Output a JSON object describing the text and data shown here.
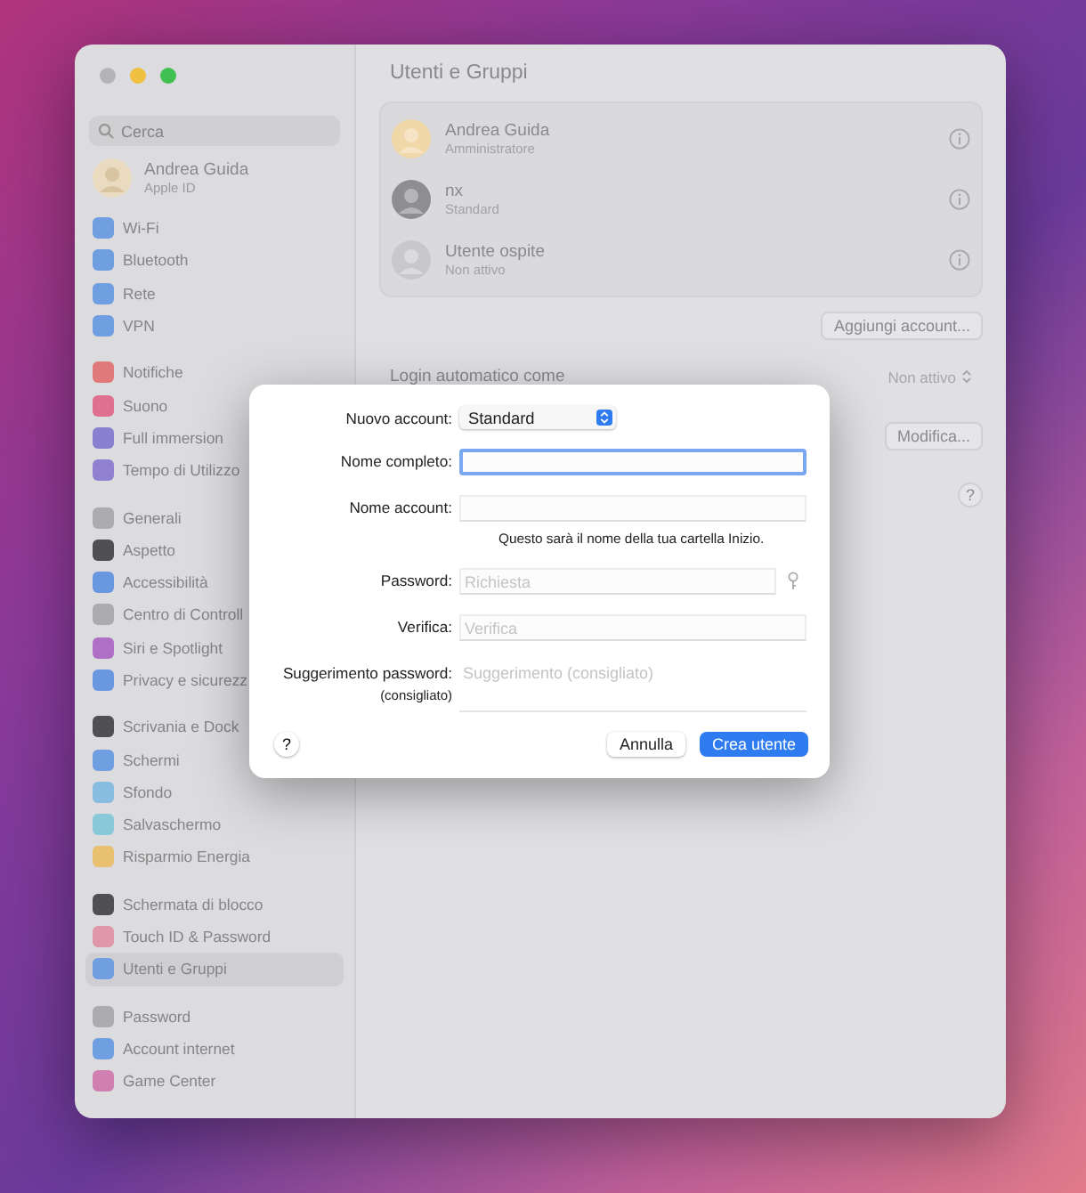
{
  "window": {
    "title": "Utenti e Gruppi"
  },
  "sidebar": {
    "search": {
      "placeholder": "Cerca"
    },
    "profile": {
      "name": "Andrea Guida",
      "subtitle": "Apple ID"
    },
    "groups": [
      [
        {
          "label": "Wi-Fi",
          "color": "#6f9fe0",
          "selected": false
        },
        {
          "label": "Bluetooth",
          "color": "#6f9fe0",
          "selected": false
        },
        {
          "label": "Rete",
          "color": "#6f9fe0",
          "selected": false
        },
        {
          "label": "VPN",
          "color": "#6f9fe0",
          "selected": false
        }
      ],
      [
        {
          "label": "Notifiche",
          "color": "#e07a7a",
          "selected": false
        },
        {
          "label": "Suono",
          "color": "#e07090",
          "selected": false
        },
        {
          "label": "Full immersion",
          "color": "#8a80d0",
          "selected": false
        },
        {
          "label": "Tempo di Utilizzo",
          "color": "#9080d0",
          "selected": false
        }
      ],
      [
        {
          "label": "Generali",
          "color": "#acacb0",
          "selected": false
        },
        {
          "label": "Aspetto",
          "color": "#505052",
          "selected": false
        },
        {
          "label": "Accessibilità",
          "color": "#6a98e0",
          "selected": false
        },
        {
          "label": "Centro di Controll",
          "color": "#acacb0",
          "selected": false
        },
        {
          "label": "Siri e Spotlight",
          "color": "#b070c8",
          "selected": false
        },
        {
          "label": "Privacy e sicurezz",
          "color": "#6a98e0",
          "selected": false
        }
      ],
      [
        {
          "label": "Scrivania e Dock",
          "color": "#505052",
          "selected": false
        },
        {
          "label": "Schermi",
          "color": "#6f9fe0",
          "selected": false
        },
        {
          "label": "Sfondo",
          "color": "#88bce0",
          "selected": false
        },
        {
          "label": "Salvaschermo",
          "color": "#88c8d8",
          "selected": false
        },
        {
          "label": "Risparmio Energia",
          "color": "#e8c070",
          "selected": false
        }
      ],
      [
        {
          "label": "Schermata di blocco",
          "color": "#505052",
          "selected": false
        },
        {
          "label": "Touch ID & Password",
          "color": "#e098a8",
          "selected": false
        },
        {
          "label": "Utenti e Gruppi",
          "color": "#6f9fe0",
          "selected": true
        }
      ],
      [
        {
          "label": "Password",
          "color": "#acacb0",
          "selected": false
        },
        {
          "label": "Account internet",
          "color": "#6f9fe0",
          "selected": false
        },
        {
          "label": "Game Center",
          "color": "#d080b0",
          "selected": false
        }
      ]
    ]
  },
  "users": [
    {
      "name": "Andrea Guida",
      "role": "Amministratore",
      "color": "#f0d8a8"
    },
    {
      "name": "nx",
      "role": "Standard",
      "color": "#8e8e92"
    },
    {
      "name": "Utente ospite",
      "role": "Non attivo",
      "color": "#c8c8cc"
    }
  ],
  "add_account_button": "Aggiungi account...",
  "auto_login": {
    "label": "Login automatico come",
    "value": "Non attivo"
  },
  "edit_button": "Modifica...",
  "help_button": "?",
  "dialog": {
    "fields": [
      {
        "kind": "popup",
        "label": "Nuovo account:",
        "value": "Standard"
      },
      {
        "kind": "text",
        "label": "Nome completo:",
        "focused": true
      },
      {
        "kind": "text",
        "label": "Nome account:",
        "focused": false,
        "note": "Questo sarà il nome della tua cartella Inizio."
      },
      {
        "kind": "password",
        "label": "Password:",
        "placeholder": "Richiesta",
        "focused": false
      },
      {
        "kind": "text",
        "label": "Verifica:",
        "placeholder": "Verifica",
        "focused": false
      },
      {
        "kind": "area",
        "label": "Suggerimento password:",
        "sublabel": "(consigliato)",
        "placeholder": "Suggerimento (consigliato)",
        "focused": false
      }
    ],
    "help_button": "?",
    "cancel_button": "Annulla",
    "create_button": "Crea utente"
  }
}
